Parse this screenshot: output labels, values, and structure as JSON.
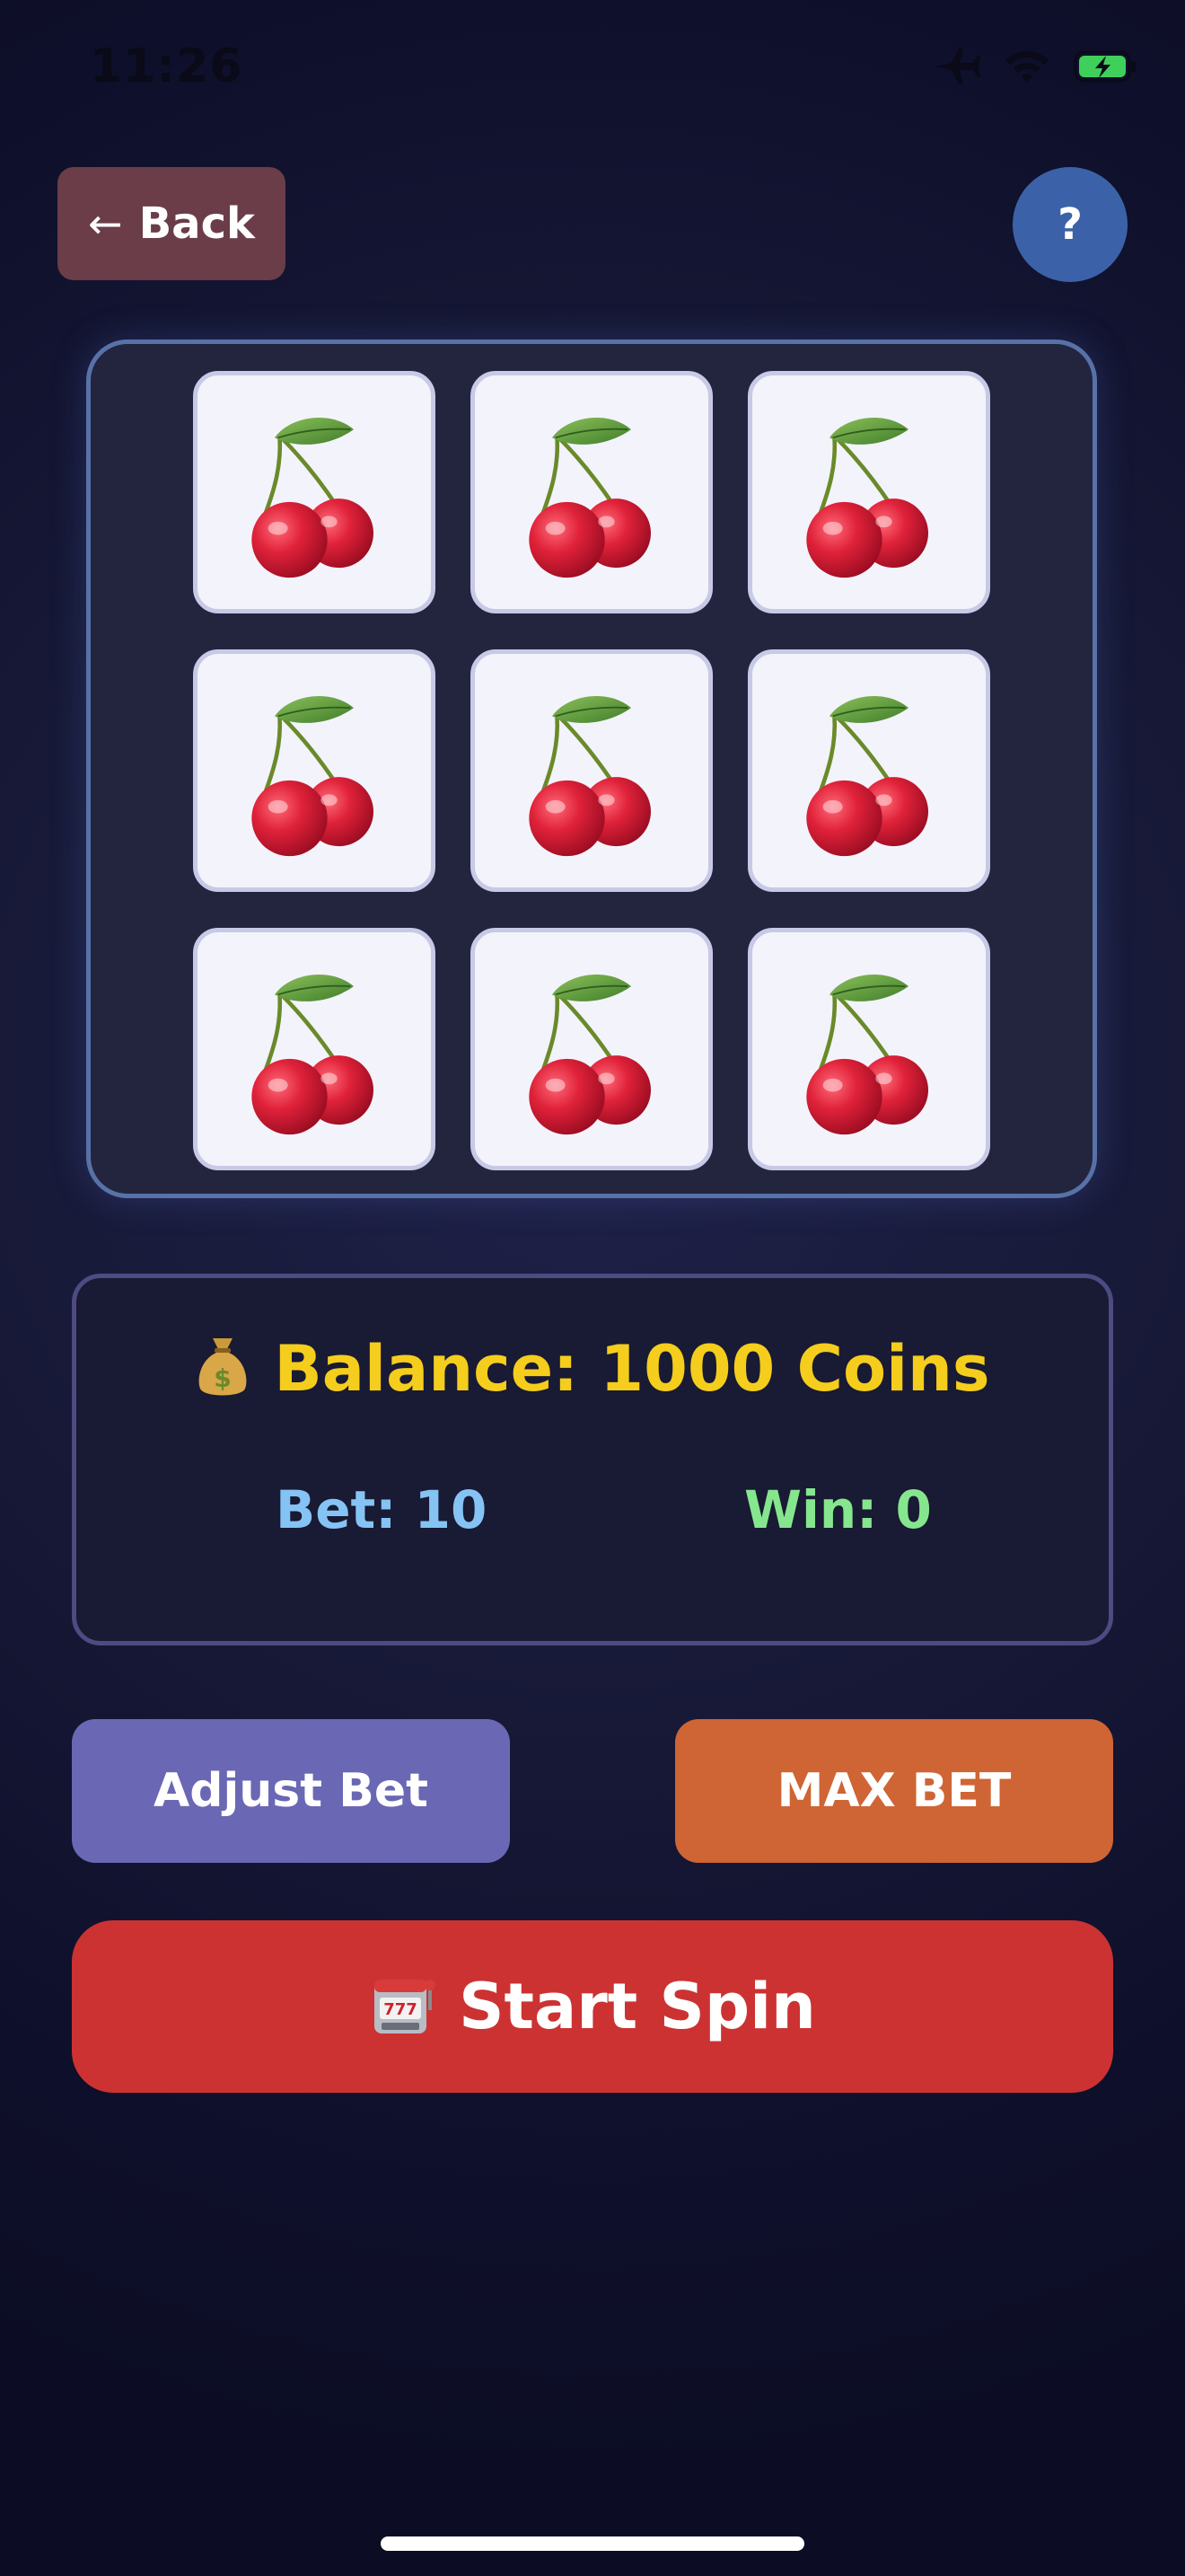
{
  "status_bar": {
    "time": "11:26",
    "icons": [
      "airplane-icon",
      "wifi-icon",
      "battery-charging-icon"
    ]
  },
  "header": {
    "back_label": "Back",
    "help_label": "?"
  },
  "reels": {
    "symbols": [
      [
        "cherry",
        "cherry",
        "cherry"
      ],
      [
        "cherry",
        "cherry",
        "cherry"
      ],
      [
        "cherry",
        "cherry",
        "cherry"
      ]
    ]
  },
  "info": {
    "balance_text": "Balance: 1000 Coins",
    "bet_text": "Bet: 10",
    "win_text": "Win: 0"
  },
  "actions": {
    "adjust_bet_label": "Adjust Bet",
    "max_bet_label": "MAX BET",
    "spin_label": "Start Spin"
  },
  "colors": {
    "background": "#12132e",
    "balance": "#f5cd1c",
    "bet": "#86c3f5",
    "win": "#86e68e",
    "adjust_bet": "#6a68b4",
    "max_bet": "#cf6434",
    "spin": "#cc3232",
    "back": "#6a3d48",
    "help": "#3b62a8"
  }
}
